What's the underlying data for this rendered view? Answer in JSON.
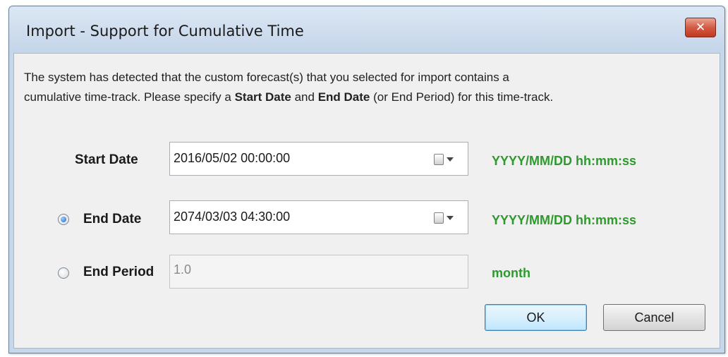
{
  "window": {
    "title": "Import - Support for Cumulative Time",
    "close_label": "✕"
  },
  "message": {
    "line1": "The system has detected that the custom forecast(s) that you selected for import contains a",
    "line2_part1": "cumulative time-track. Please specify a ",
    "line2_bold1": "Start Date",
    "line2_part2": " and ",
    "line2_bold2": "End Date",
    "line2_part3": " (or End Period) for this time-track."
  },
  "start_date": {
    "label": "Start Date",
    "value": "2016/05/02 00:00:00",
    "format_hint": "YYYY/MM/DD hh:mm:ss",
    "calendar_icon": "calendar-icon"
  },
  "end_date": {
    "label": "End Date",
    "value": "2074/03/03 04:30:00",
    "format_hint": "YYYY/MM/DD hh:mm:ss",
    "selected": true,
    "calendar_icon": "calendar-icon"
  },
  "end_period": {
    "label": "End Period",
    "value": "1.0",
    "unit": "month",
    "selected": false
  },
  "buttons": {
    "ok_label": "OK",
    "cancel_label": "Cancel"
  },
  "colors": {
    "hint_green": "#2e9a2e",
    "close_red": "#c23a22",
    "default_button_border": "#3c7fb1"
  }
}
